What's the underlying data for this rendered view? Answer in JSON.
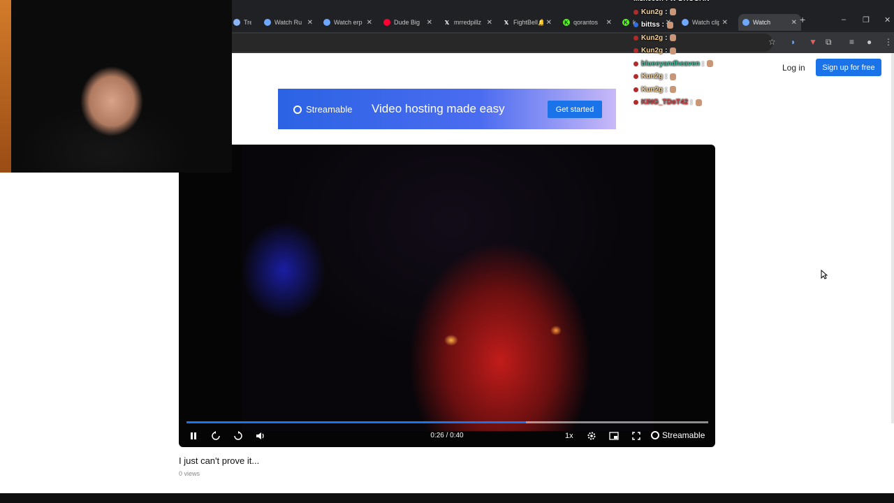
{
  "browser": {
    "tabs": [
      {
        "label": "Trey",
        "icon": "globe-icon",
        "color": "#8ab4f8"
      },
      {
        "label": "Watch Ru",
        "icon": "streamable-tab-icon",
        "color": "#6ea8fe"
      },
      {
        "label": "Watch erp",
        "icon": "streamable-tab-icon",
        "color": "#6ea8fe"
      },
      {
        "label": "Dude Big",
        "icon": "youtube-tab-icon",
        "color": "#ff0033"
      },
      {
        "label": "mrredpillz",
        "icon": "x-tab-icon",
        "color": "#ffffff"
      },
      {
        "label": "FightBell🔔",
        "icon": "x-tab-icon",
        "color": "#ffffff"
      },
      {
        "label": "qorantos",
        "icon": "kick-tab-icon",
        "color": "#53fc18"
      },
      {
        "label": "k",
        "icon": "kick-tab-icon",
        "color": "#53fc18"
      },
      {
        "label": "Watch clip",
        "icon": "streamable-tab-icon",
        "color": "#6ea8fe"
      },
      {
        "label": "Watch",
        "icon": "streamable-tab-icon",
        "color": "#6ea8fe",
        "active": true
      }
    ],
    "new_tab": "+",
    "window_controls": {
      "minimize": "–",
      "restore": "❐",
      "close": "✕"
    }
  },
  "chat": [
    {
      "user": "lilsheech",
      "message": ": W DROGAN",
      "color": "#ffffff"
    },
    {
      "user": "Kun2g",
      "message": ":",
      "color": "#f5d39b",
      "dot": "#b22b2b"
    },
    {
      "user": "bittss",
      "message": ":",
      "color": "#ffffff",
      "dot": "#2f6fe0"
    },
    {
      "user": "Kun2g",
      "message": ":",
      "color": "#f5d39b",
      "dot": "#b22b2b"
    },
    {
      "user": "Kun2g",
      "message": ":",
      "color": "#f5d39b",
      "dot": "#b22b2b"
    },
    {
      "user": "blueeyandheaven",
      "message": ":",
      "color": "#3fbf9c",
      "dot": "#b22b2b"
    },
    {
      "user": "Kun2g",
      "message": ":",
      "color": "#f5d39b",
      "dot": "#b22b2b"
    },
    {
      "user": "Kun2g",
      "message": ":",
      "color": "#f5d39b",
      "dot": "#b22b2b"
    },
    {
      "user": "KING_TDoT42",
      "message": ":",
      "color": "#d14a4a",
      "dot": "#b22b2b"
    }
  ],
  "header": {
    "login": "Log in",
    "signup": "Sign up for free"
  },
  "ad": {
    "brand": "Streamable",
    "tagline": "Video hosting made easy",
    "cta": "Get started"
  },
  "player": {
    "time": "0:26 / 0:40",
    "progress": 0.65,
    "speed": "1x",
    "brand": "Streamable"
  },
  "video": {
    "title": "I just can't prove it...",
    "views": "0 views"
  },
  "colors": {
    "accent": "#1a73e8",
    "chrome_dark": "#202124"
  }
}
